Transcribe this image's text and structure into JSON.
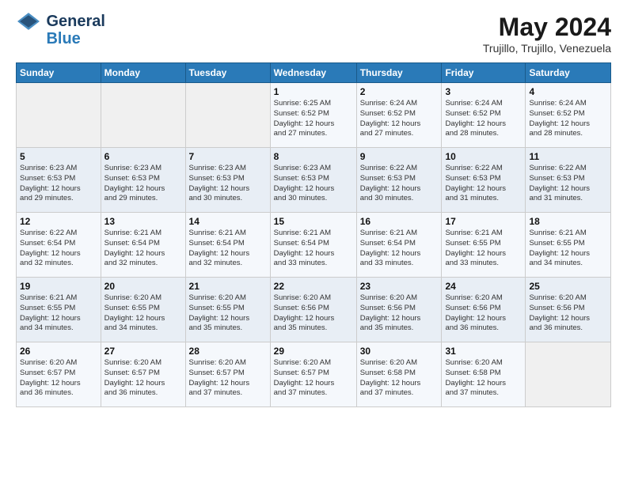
{
  "header": {
    "logo_line1": "General",
    "logo_line2": "Blue",
    "month": "May 2024",
    "location": "Trujillo, Trujillo, Venezuela"
  },
  "weekdays": [
    "Sunday",
    "Monday",
    "Tuesday",
    "Wednesday",
    "Thursday",
    "Friday",
    "Saturday"
  ],
  "weeks": [
    [
      {
        "day": "",
        "info": ""
      },
      {
        "day": "",
        "info": ""
      },
      {
        "day": "",
        "info": ""
      },
      {
        "day": "1",
        "info": "Sunrise: 6:25 AM\nSunset: 6:52 PM\nDaylight: 12 hours\nand 27 minutes."
      },
      {
        "day": "2",
        "info": "Sunrise: 6:24 AM\nSunset: 6:52 PM\nDaylight: 12 hours\nand 27 minutes."
      },
      {
        "day": "3",
        "info": "Sunrise: 6:24 AM\nSunset: 6:52 PM\nDaylight: 12 hours\nand 28 minutes."
      },
      {
        "day": "4",
        "info": "Sunrise: 6:24 AM\nSunset: 6:52 PM\nDaylight: 12 hours\nand 28 minutes."
      }
    ],
    [
      {
        "day": "5",
        "info": "Sunrise: 6:23 AM\nSunset: 6:53 PM\nDaylight: 12 hours\nand 29 minutes."
      },
      {
        "day": "6",
        "info": "Sunrise: 6:23 AM\nSunset: 6:53 PM\nDaylight: 12 hours\nand 29 minutes."
      },
      {
        "day": "7",
        "info": "Sunrise: 6:23 AM\nSunset: 6:53 PM\nDaylight: 12 hours\nand 30 minutes."
      },
      {
        "day": "8",
        "info": "Sunrise: 6:23 AM\nSunset: 6:53 PM\nDaylight: 12 hours\nand 30 minutes."
      },
      {
        "day": "9",
        "info": "Sunrise: 6:22 AM\nSunset: 6:53 PM\nDaylight: 12 hours\nand 30 minutes."
      },
      {
        "day": "10",
        "info": "Sunrise: 6:22 AM\nSunset: 6:53 PM\nDaylight: 12 hours\nand 31 minutes."
      },
      {
        "day": "11",
        "info": "Sunrise: 6:22 AM\nSunset: 6:53 PM\nDaylight: 12 hours\nand 31 minutes."
      }
    ],
    [
      {
        "day": "12",
        "info": "Sunrise: 6:22 AM\nSunset: 6:54 PM\nDaylight: 12 hours\nand 32 minutes."
      },
      {
        "day": "13",
        "info": "Sunrise: 6:21 AM\nSunset: 6:54 PM\nDaylight: 12 hours\nand 32 minutes."
      },
      {
        "day": "14",
        "info": "Sunrise: 6:21 AM\nSunset: 6:54 PM\nDaylight: 12 hours\nand 32 minutes."
      },
      {
        "day": "15",
        "info": "Sunrise: 6:21 AM\nSunset: 6:54 PM\nDaylight: 12 hours\nand 33 minutes."
      },
      {
        "day": "16",
        "info": "Sunrise: 6:21 AM\nSunset: 6:54 PM\nDaylight: 12 hours\nand 33 minutes."
      },
      {
        "day": "17",
        "info": "Sunrise: 6:21 AM\nSunset: 6:55 PM\nDaylight: 12 hours\nand 33 minutes."
      },
      {
        "day": "18",
        "info": "Sunrise: 6:21 AM\nSunset: 6:55 PM\nDaylight: 12 hours\nand 34 minutes."
      }
    ],
    [
      {
        "day": "19",
        "info": "Sunrise: 6:21 AM\nSunset: 6:55 PM\nDaylight: 12 hours\nand 34 minutes."
      },
      {
        "day": "20",
        "info": "Sunrise: 6:20 AM\nSunset: 6:55 PM\nDaylight: 12 hours\nand 34 minutes."
      },
      {
        "day": "21",
        "info": "Sunrise: 6:20 AM\nSunset: 6:55 PM\nDaylight: 12 hours\nand 35 minutes."
      },
      {
        "day": "22",
        "info": "Sunrise: 6:20 AM\nSunset: 6:56 PM\nDaylight: 12 hours\nand 35 minutes."
      },
      {
        "day": "23",
        "info": "Sunrise: 6:20 AM\nSunset: 6:56 PM\nDaylight: 12 hours\nand 35 minutes."
      },
      {
        "day": "24",
        "info": "Sunrise: 6:20 AM\nSunset: 6:56 PM\nDaylight: 12 hours\nand 36 minutes."
      },
      {
        "day": "25",
        "info": "Sunrise: 6:20 AM\nSunset: 6:56 PM\nDaylight: 12 hours\nand 36 minutes."
      }
    ],
    [
      {
        "day": "26",
        "info": "Sunrise: 6:20 AM\nSunset: 6:57 PM\nDaylight: 12 hours\nand 36 minutes."
      },
      {
        "day": "27",
        "info": "Sunrise: 6:20 AM\nSunset: 6:57 PM\nDaylight: 12 hours\nand 36 minutes."
      },
      {
        "day": "28",
        "info": "Sunrise: 6:20 AM\nSunset: 6:57 PM\nDaylight: 12 hours\nand 37 minutes."
      },
      {
        "day": "29",
        "info": "Sunrise: 6:20 AM\nSunset: 6:57 PM\nDaylight: 12 hours\nand 37 minutes."
      },
      {
        "day": "30",
        "info": "Sunrise: 6:20 AM\nSunset: 6:58 PM\nDaylight: 12 hours\nand 37 minutes."
      },
      {
        "day": "31",
        "info": "Sunrise: 6:20 AM\nSunset: 6:58 PM\nDaylight: 12 hours\nand 37 minutes."
      },
      {
        "day": "",
        "info": ""
      }
    ]
  ]
}
